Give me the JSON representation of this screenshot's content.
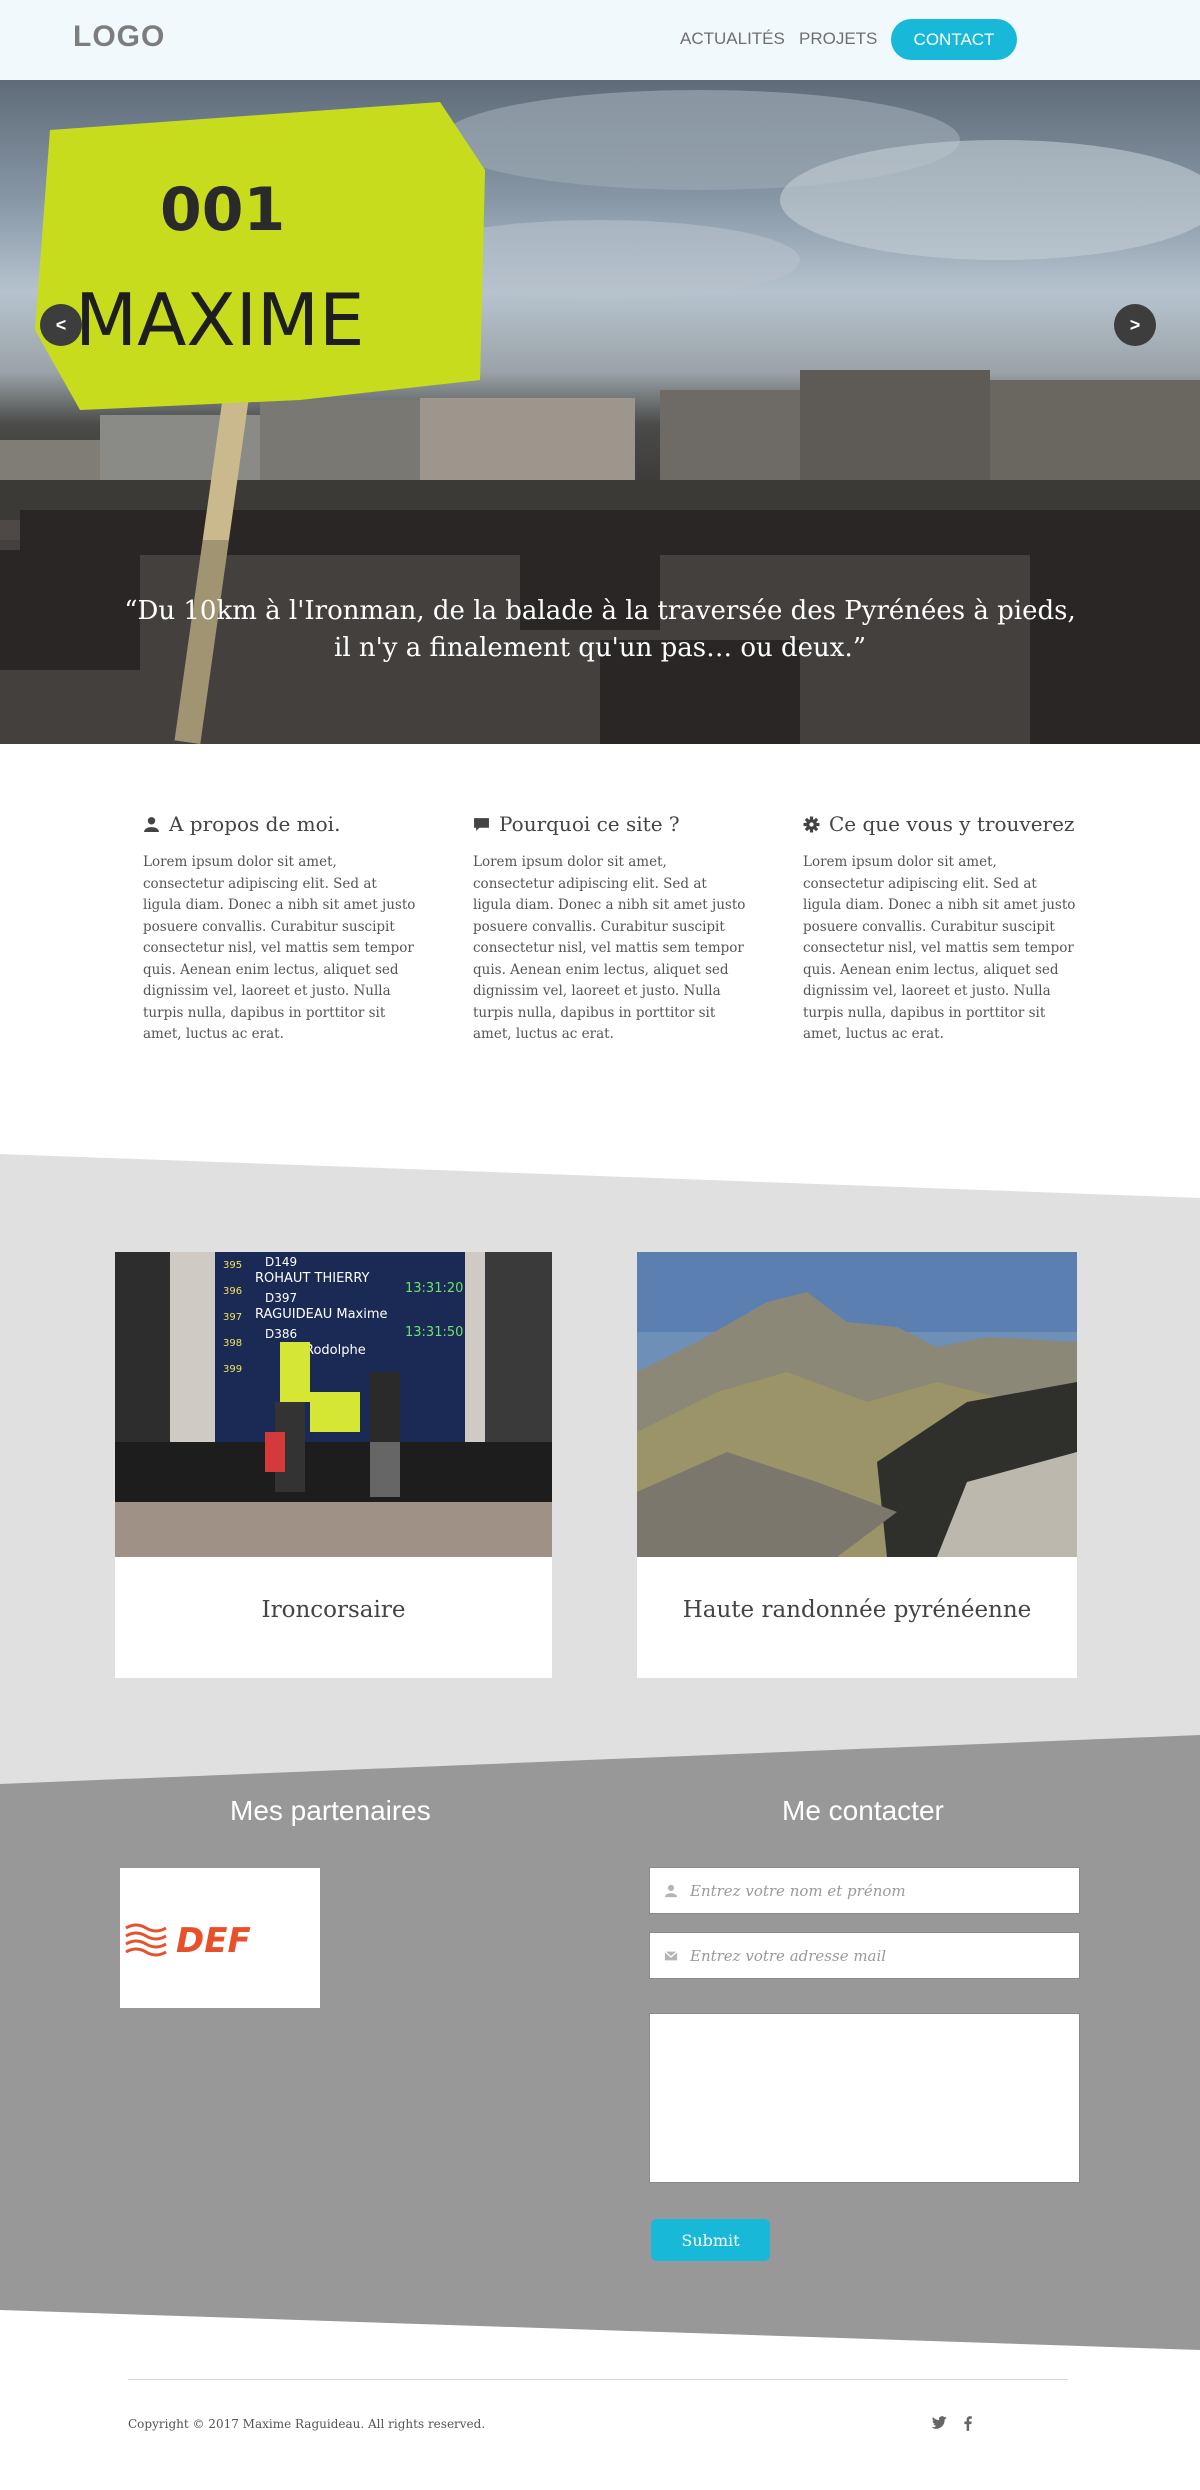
{
  "header": {
    "logo": "LOGO",
    "nav": {
      "actualites": "ACTUALITÉS",
      "projets": "PROJETS",
      "contact": "CONTACT"
    }
  },
  "hero": {
    "sign_text": "MAXIME",
    "sign_number": "001",
    "quote": "“Du 10km à l'Ironman, de la balade à la traversée des Pyrénées à pieds, il n'y a finalement qu'un pas… ou deux.”",
    "prev_arrow": "<",
    "next_arrow": ">"
  },
  "intro": [
    {
      "icon": "user-icon",
      "title": "A propos de moi.",
      "text": "Lorem ipsum dolor sit amet, consectetur adipiscing elit. Sed at ligula diam. Donec a nibh sit amet justo posuere convallis. Curabitur suscipit consectetur nisl, vel mattis sem tempor quis. Aenean enim lectus, aliquet sed dignissim vel, laoreet et justo. Nulla turpis nulla, dapibus in porttitor sit amet, luctus ac erat."
    },
    {
      "icon": "comment-icon",
      "title": "Pourquoi ce site ?",
      "text": "Lorem ipsum dolor sit amet, consectetur adipiscing elit. Sed at ligula diam. Donec a nibh sit amet justo posuere convallis. Curabitur suscipit consectetur nisl, vel mattis sem tempor quis. Aenean enim lectus, aliquet sed dignissim vel, laoreet et justo. Nulla turpis nulla, dapibus in porttitor sit amet, luctus ac erat."
    },
    {
      "icon": "gear-icon",
      "title": "Ce que vous y trouverez",
      "text": "Lorem ipsum dolor sit amet, consectetur adipiscing elit. Sed at ligula diam. Donec a nibh sit amet justo posuere convallis. Curabitur suscipit consectetur nisl, vel mattis sem tempor quis. Aenean enim lectus, aliquet sed dignissim vel, laoreet et justo. Nulla turpis nulla, dapibus in porttitor sit amet, luctus ac erat."
    }
  ],
  "projects": [
    {
      "title": "Ironcorsaire",
      "board_lines": [
        "D149",
        "ROHAUT THIERRY",
        "D397",
        "RAGUIDEAU Maxime",
        "D386",
        "Rodolphe"
      ],
      "board_times": [
        "13:31:20",
        "13:31:50"
      ],
      "board_numbers": [
        "395",
        "396",
        "397",
        "398",
        "399"
      ]
    },
    {
      "title": "Haute randonnée pyrénéenne"
    }
  ],
  "partners": {
    "title": "Mes partenaires",
    "logo_text": "DEF"
  },
  "contact": {
    "title": "Me contacter",
    "name_placeholder": "Entrez votre nom et prénom",
    "email_placeholder": "Entrez votre adresse mail",
    "message_value": "",
    "submit_label": "Submit"
  },
  "footer": {
    "copyright": "Copyright © 2017 Maxime Raguideau. All rights reserved.",
    "social": [
      "twitter-icon",
      "facebook-icon"
    ]
  },
  "colors": {
    "accent": "#18b8d8",
    "light_band": "#e0e0e0",
    "dark_band": "#989898",
    "header_bg": "#f2f9fd",
    "sign_yellow": "#c8dc1e",
    "def_red": "#e8502a"
  }
}
